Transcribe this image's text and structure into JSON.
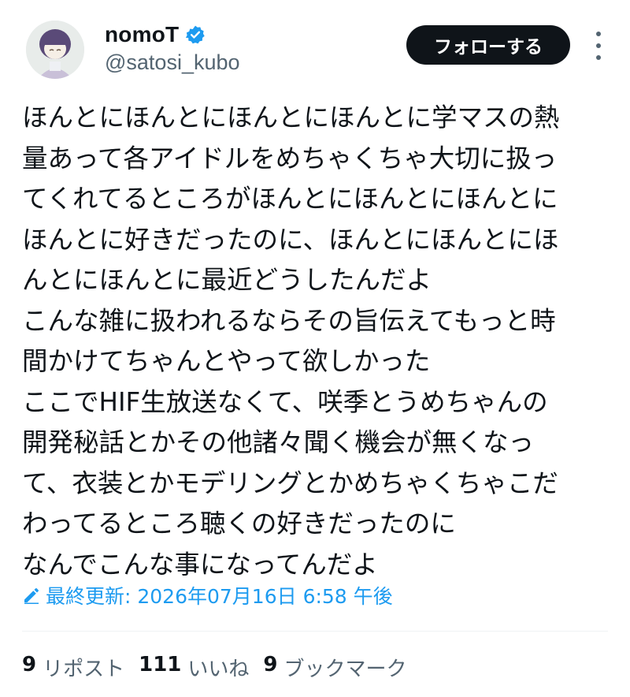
{
  "user": {
    "display_name": "nomoT",
    "handle": "@satosi_kubo",
    "verified": true
  },
  "follow_label": "フォローする",
  "tweet_lines": [
    "ほんとにほんとにほんとにほんとに学マスの熱",
    "量あって各アイドルをめちゃくちゃ大切に扱っ",
    "てくれてるところがほんとにほんとにほんとに",
    "ほんとに好きだったのに、ほんとにほんとにほ",
    "んとにほんとに最近どうしたんだよ",
    "こんな雑に扱われるならその旨伝えてもっと時",
    "間かけてちゃんとやって欲しかった",
    "ここでHIF生放送なくて、咲季とうめちゃんの",
    "開発秘話とかその他諸々聞く機会が無くなっ",
    "て、衣装とかモデリングとかめちゃくちゃこだ",
    "わってるところ聴くの好きだったのに",
    "なんでこんな事になってんだよ"
  ],
  "edited": {
    "text": "最終更新: 2026年07月16日 6:58 午後",
    "icon": "pencil-icon"
  },
  "stats": {
    "reposts_count": "9",
    "reposts_label": "リポスト",
    "likes_count": "111",
    "likes_label": "いいね",
    "bookmarks_count": "9",
    "bookmarks_label": "ブックマーク"
  },
  "colors": {
    "accent": "#1d9bf0",
    "text": "#0f1419",
    "muted": "#536471",
    "button_bg": "#0f1419"
  }
}
